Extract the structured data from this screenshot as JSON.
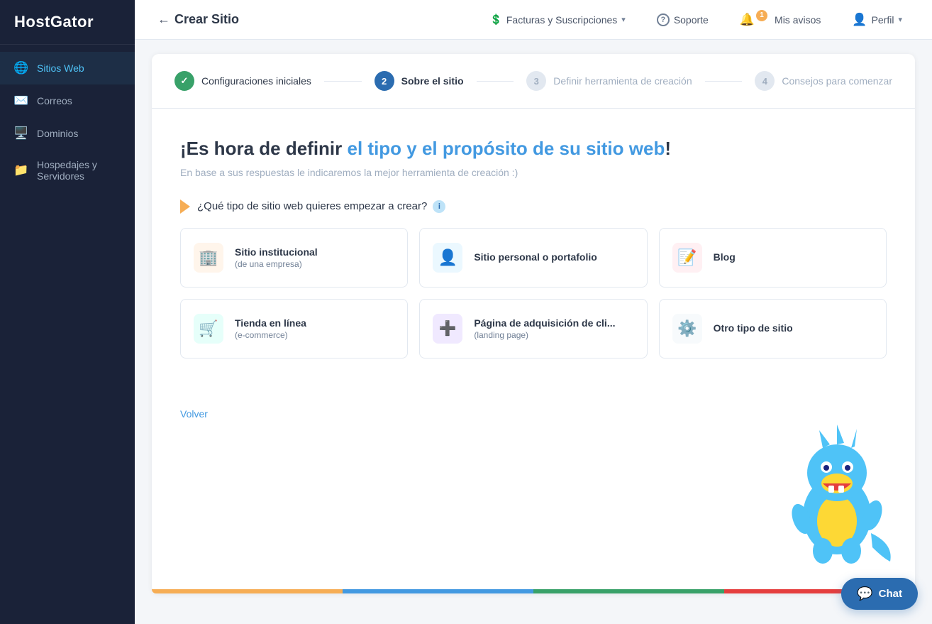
{
  "sidebar": {
    "logo": "HostGator",
    "items": [
      {
        "id": "sitios-web",
        "label": "Sitios Web",
        "icon": "🌐",
        "active": true
      },
      {
        "id": "correos",
        "label": "Correos",
        "icon": "✉️",
        "active": false
      },
      {
        "id": "dominios",
        "label": "Dominios",
        "icon": "🖥️",
        "active": false
      },
      {
        "id": "hospedajes",
        "label": "Hospedajes y Servidores",
        "icon": "📁",
        "active": false
      }
    ]
  },
  "header": {
    "back_label": "Crear Sitio",
    "nav_items": [
      {
        "id": "facturas",
        "label": "Facturas y Suscripciones",
        "has_chevron": true,
        "icon": "💲"
      },
      {
        "id": "soporte",
        "label": "Soporte",
        "has_chevron": false,
        "icon": "?"
      },
      {
        "id": "avisos",
        "label": "Mis avisos",
        "has_chevron": false,
        "icon": "🔔",
        "badge": "1"
      },
      {
        "id": "perfil",
        "label": "Perfil",
        "has_chevron": true,
        "icon": "👤"
      }
    ]
  },
  "steps": [
    {
      "id": "step-1",
      "number": "✓",
      "label": "Configuraciones iniciales",
      "state": "done"
    },
    {
      "id": "step-2",
      "number": "2",
      "label": "Sobre el sitio",
      "state": "active"
    },
    {
      "id": "step-3",
      "number": "3",
      "label": "Definir herramienta de creación",
      "state": "inactive"
    },
    {
      "id": "step-4",
      "number": "4",
      "label": "Consejos para comenzar",
      "state": "inactive"
    }
  ],
  "wizard": {
    "heading_part1": "¡Es hora de definir el tipo y el propósito de su sitio web!",
    "subtext": "En base a sus respuestas le indicaremos la mejor herramienta de creación :)",
    "question": "¿Qué tipo de sitio web quieres empezar a crear?",
    "back_label": "Volver",
    "cards": [
      {
        "id": "institucional",
        "title": "Sitio institucional",
        "subtitle": "(de una empresa)",
        "icon_type": "orange",
        "icon": "🏢"
      },
      {
        "id": "personal",
        "title": "Sitio personal o portafolio",
        "subtitle": "",
        "icon_type": "blue",
        "icon": "👤"
      },
      {
        "id": "blog",
        "title": "Blog",
        "subtitle": "",
        "icon_type": "pink",
        "icon": "📝"
      },
      {
        "id": "tienda",
        "title": "Tienda en línea",
        "subtitle": "(e-commerce)",
        "icon_type": "teal",
        "icon": "🛒"
      },
      {
        "id": "landing",
        "title": "Página de adquisición de cli...",
        "subtitle": "(landing page)",
        "icon_type": "purple",
        "icon": "➕"
      },
      {
        "id": "otro",
        "title": "Otro tipo de sitio",
        "subtitle": "",
        "icon_type": "gray",
        "icon": "⚙️"
      }
    ]
  },
  "chat": {
    "label": "Chat"
  }
}
